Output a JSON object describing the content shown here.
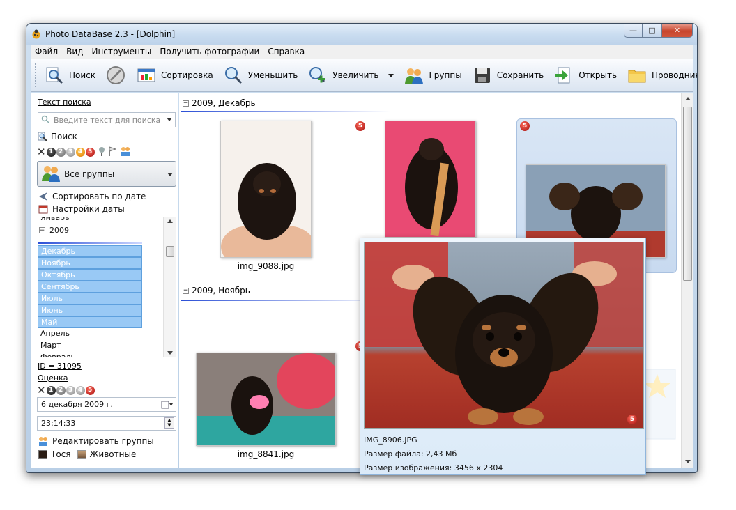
{
  "window": {
    "title": "Photo DataBase 2.3 - [Dolphin]",
    "min_glyph": "—",
    "max_glyph": "□",
    "close_glyph": "✕"
  },
  "menu": [
    "Файл",
    "Вид",
    "Инструменты",
    "Получить фотографии",
    "Справка"
  ],
  "toolbar": {
    "search": "Поиск",
    "sort": "Сортировка",
    "zoom_out": "Уменьшить",
    "zoom_in": "Увеличить",
    "groups": "Группы",
    "save": "Сохранить",
    "open": "Открыть",
    "explorer": "Проводник"
  },
  "left": {
    "search_text_label": "Текст поиска",
    "search_placeholder": "Введите текст для поиска",
    "search_btn": "Поиск",
    "rating_badges": [
      "1",
      "2",
      "3",
      "4",
      "5"
    ],
    "group_combo": "Все группы",
    "sort_by_date": "Сортировать по дате",
    "date_settings": "Настройки даты",
    "tree_year": "2009",
    "tree_prev_month": "Январь",
    "months_selected": [
      "Декабрь",
      "Ноябрь",
      "Октябрь",
      "Сентябрь",
      "Июль",
      "Июнь",
      "Май"
    ],
    "months_plain": [
      "Апрель",
      "Март",
      "Февраль"
    ],
    "id_label": "ID = 31095",
    "rating_label": "Оценка",
    "date_value": "6 декабря  2009 г.",
    "time_value": "23:14:33",
    "edit_groups": "Редактировать группы",
    "group_tags": [
      "Тося",
      "Животные"
    ]
  },
  "content": {
    "groups": [
      {
        "header": "2009, Декабрь"
      },
      {
        "header": "2009, Ноябрь"
      }
    ],
    "captions": [
      "img_9088.jpg",
      "img_8841.jpg"
    ],
    "rating_badge": "5"
  },
  "popup": {
    "filename": "IMG_8906.JPG",
    "filesize": "Размер файла: 2,43 Мб",
    "imagesize": "Размер изображения: 3456 x 2304",
    "rating_badge": "5"
  },
  "colors": {
    "accent": "#5ea0de",
    "selection": "#99c9f5",
    "rating_red": "#a30f0f"
  }
}
